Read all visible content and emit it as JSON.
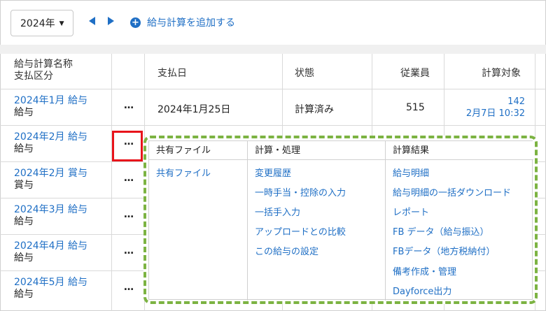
{
  "toolbar": {
    "year": "2024年",
    "add_label": "給与計算を追加する"
  },
  "table": {
    "headers": {
      "name_line1": "給与計算名称",
      "name_line2": "支払区分",
      "pay_date": "支払日",
      "status": "状態",
      "employees": "従業員",
      "calc_target": "計算対象"
    },
    "rows": [
      {
        "name": "2024年1月 給与",
        "kind": "給与",
        "dots": "…",
        "pay_date": "2024年1月25日",
        "status": "計算済み",
        "employees": "515",
        "calc_count": "142",
        "calc_time": "2月7日 10:32"
      },
      {
        "name": "2024年2月 給与",
        "kind": "給与",
        "dots": "…"
      },
      {
        "name": "2024年2月 賞与",
        "kind": "賞与",
        "dots": "…"
      },
      {
        "name": "2024年3月 給与",
        "kind": "給与",
        "dots": "…"
      },
      {
        "name": "2024年4月 給与",
        "kind": "給与",
        "dots": "…"
      },
      {
        "name": "2024年5月 給与",
        "kind": "給与",
        "dots": "…"
      }
    ]
  },
  "menu": {
    "col1_title": "共有ファイル",
    "col1_items": [
      "共有ファイル"
    ],
    "col2_title": "計算・処理",
    "col2_items": [
      "変更履歴",
      "一時手当・控除の入力",
      "一括手入力",
      "アップロードとの比較",
      "この給与の設定"
    ],
    "col3_title": "計算結果",
    "col3_items": [
      "給与明細",
      "給与明細の一括ダウンロード",
      "レポート",
      "FB データ（給与振込）",
      "FBデータ（地方税納付）",
      "備考作成・管理",
      "Dayforce出力"
    ]
  }
}
